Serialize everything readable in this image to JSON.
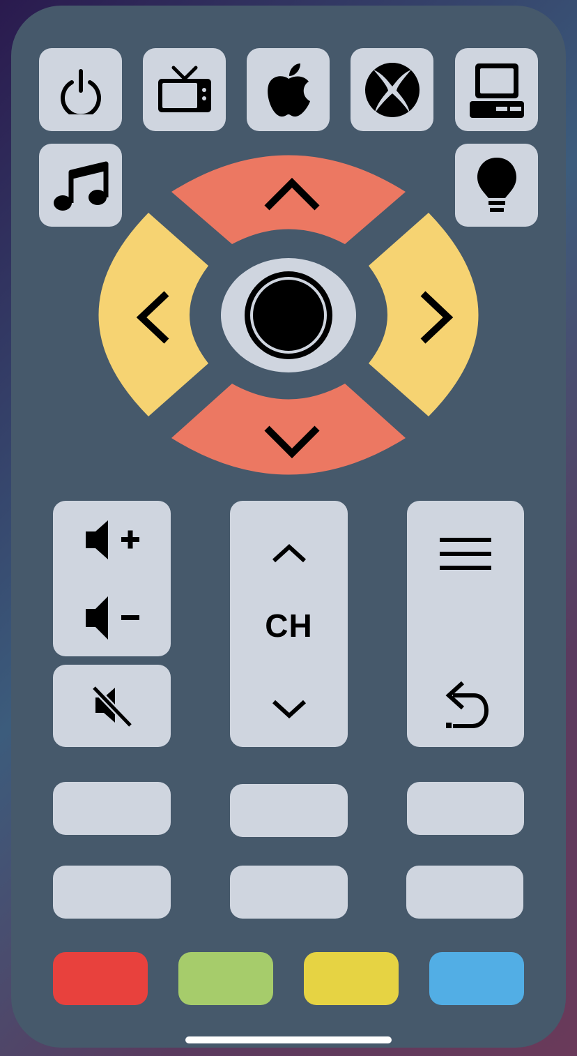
{
  "sources": [
    {
      "id": "power",
      "icon": "power-icon"
    },
    {
      "id": "tv",
      "icon": "tv-icon"
    },
    {
      "id": "apple",
      "icon": "apple-icon"
    },
    {
      "id": "xbox",
      "icon": "xbox-icon"
    },
    {
      "id": "computer",
      "icon": "computer-icon"
    },
    {
      "id": "music",
      "icon": "music-note-icon"
    },
    {
      "id": "light",
      "icon": "lightbulb-icon"
    }
  ],
  "dpad": {
    "up": {
      "icon": "chevron-up-icon",
      "color": "#ec7862"
    },
    "down": {
      "icon": "chevron-down-icon",
      "color": "#ec7862"
    },
    "left": {
      "icon": "chevron-left-icon",
      "color": "#f6d372"
    },
    "right": {
      "icon": "chevron-right-icon",
      "color": "#f6d372"
    },
    "ok": {
      "icon": "ok-circle-icon",
      "color": "#cfd5df"
    }
  },
  "volume": {
    "up_icon": "volume-up-icon",
    "down_icon": "volume-down-icon",
    "mute_icon": "mute-icon"
  },
  "channel": {
    "label": "CH",
    "up_icon": "chevron-up-icon",
    "down_icon": "chevron-down-icon"
  },
  "menu": {
    "menu_icon": "menu-icon",
    "back_icon": "back-icon"
  },
  "blank_buttons": 6,
  "color_keys": [
    {
      "name": "red",
      "color": "#e8413d"
    },
    {
      "name": "green",
      "color": "#a6cc6b"
    },
    {
      "name": "yellow",
      "color": "#e6d343"
    },
    {
      "name": "blue",
      "color": "#52aee5"
    }
  ],
  "colors": {
    "body": "#46596b",
    "button": "#cfd5df"
  }
}
